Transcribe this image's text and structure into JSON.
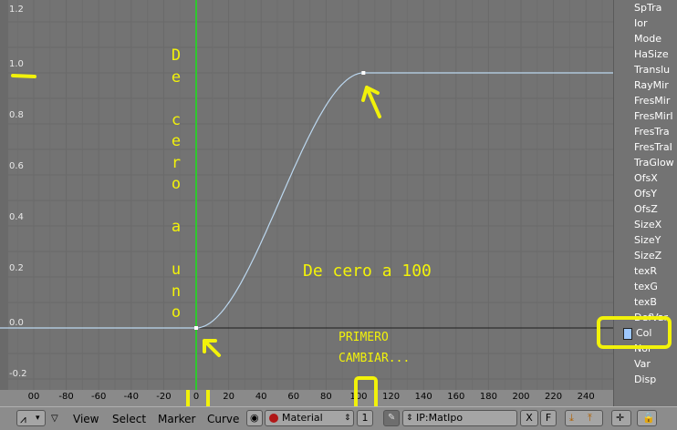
{
  "graph": {
    "y_labels": [
      "1.2",
      "1.0",
      "0.8",
      "0.6",
      "0.4",
      "0.2",
      "0.0",
      "-0.2"
    ],
    "x_labels": [
      "00",
      "-80",
      "-60",
      "-40",
      "-20",
      "0",
      "20",
      "40",
      "60",
      "80",
      "100",
      "120",
      "140",
      "160",
      "180",
      "200",
      "220",
      "240"
    ],
    "curve_color": "#bcd8f0",
    "cursor_color": "#2ec82e"
  },
  "channels": {
    "items": [
      "SpTra",
      "Ior",
      "Mode",
      "HaSize",
      "Translu",
      "RayMir",
      "FresMir",
      "FresMirI",
      "FresTra",
      "FresTraI",
      "TraGlow",
      "OfsX",
      "OfsY",
      "OfsZ",
      "SizeX",
      "SizeY",
      "SizeZ",
      "texR",
      "texG",
      "texB",
      "DefVar",
      "Col",
      "Nor",
      "Var",
      "Disp"
    ],
    "active": "Col"
  },
  "annotations": {
    "vertical_text": [
      "D",
      "e",
      "",
      "c",
      "e",
      "r",
      "o",
      "",
      "a",
      "",
      "u",
      "n",
      "o"
    ],
    "horizontal_text": "De cero a 100",
    "note_line1": "PRIMERO",
    "note_line2": "CAMBIAR...",
    "color": "#f2f20a"
  },
  "header": {
    "menu_view": "View",
    "menu_select": "Select",
    "menu_marker": "Marker",
    "menu_curve": "Curve",
    "block_type": "Material",
    "block_num": "1",
    "ipo_name": "IP:MatIpo",
    "clear_label": "X",
    "fake_label": "F"
  }
}
